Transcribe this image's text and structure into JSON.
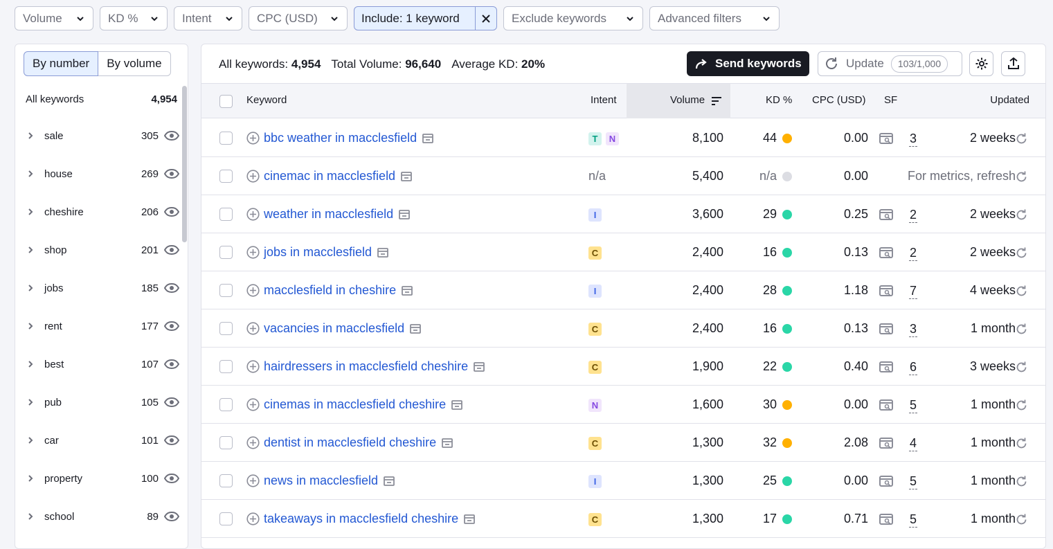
{
  "filters": {
    "volume": "Volume",
    "kd": "KD %",
    "intent": "Intent",
    "cpc": "CPC (USD)",
    "include": "Include: 1 keyword",
    "exclude": "Exclude keywords",
    "advanced": "Advanced filters"
  },
  "groups_panel": {
    "by_number": "By number",
    "by_volume": "By volume",
    "all_label": "All keywords",
    "all_count": "4,954",
    "items": [
      {
        "name": "sale",
        "count": "305"
      },
      {
        "name": "house",
        "count": "269"
      },
      {
        "name": "cheshire",
        "count": "206"
      },
      {
        "name": "shop",
        "count": "201"
      },
      {
        "name": "jobs",
        "count": "185"
      },
      {
        "name": "rent",
        "count": "177"
      },
      {
        "name": "best",
        "count": "107"
      },
      {
        "name": "pub",
        "count": "105"
      },
      {
        "name": "car",
        "count": "101"
      },
      {
        "name": "property",
        "count": "100"
      },
      {
        "name": "school",
        "count": "89"
      }
    ]
  },
  "summary": {
    "all_label": "All keywords:",
    "all_value": "4,954",
    "volume_label": "Total Volume:",
    "volume_value": "96,640",
    "kd_label": "Average KD:",
    "kd_value": "20%"
  },
  "toolbar": {
    "send_label": "Send keywords",
    "update_label": "Update",
    "update_quota": "103/1,000"
  },
  "table": {
    "headers": {
      "keyword": "Keyword",
      "intent": "Intent",
      "volume": "Volume",
      "kd": "KD %",
      "cpc": "CPC (USD)",
      "sf": "SF",
      "updated": "Updated"
    },
    "colors": {
      "intent_T": "#d3f3ee",
      "intent_T_text": "#009f81",
      "intent_N": "#f1e5fc",
      "intent_N_text": "#8649e1",
      "intent_I": "#dee4fe",
      "intent_I_text": "#3c62e5",
      "intent_C": "#ffe28f",
      "intent_C_text": "#6b4d00",
      "kd_orange": "#ffb000",
      "kd_green": "#2ad6a7",
      "kd_gray": "#dcdde3"
    },
    "rows": [
      {
        "keyword": "bbc weather in macclesfield",
        "intents": [
          "T",
          "N"
        ],
        "volume": "8,100",
        "kd": "44",
        "kd_color": "orange",
        "cpc": "0.00",
        "sf": "3",
        "updated": "2 weeks"
      },
      {
        "keyword": "cinemac in macclesfield",
        "intents": [],
        "intent_na": "n/a",
        "volume": "5,400",
        "kd": "n/a",
        "kd_color": "gray",
        "cpc": "0.00",
        "sf": "",
        "updated": "For metrics, refresh"
      },
      {
        "keyword": "weather in macclesfield",
        "intents": [
          "I"
        ],
        "volume": "3,600",
        "kd": "29",
        "kd_color": "green",
        "cpc": "0.25",
        "sf": "2",
        "updated": "2 weeks"
      },
      {
        "keyword": "jobs in macclesfield",
        "intents": [
          "C"
        ],
        "volume": "2,400",
        "kd": "16",
        "kd_color": "green",
        "cpc": "0.13",
        "sf": "2",
        "updated": "2 weeks"
      },
      {
        "keyword": "macclesfield in cheshire",
        "intents": [
          "I"
        ],
        "volume": "2,400",
        "kd": "28",
        "kd_color": "green",
        "cpc": "1.18",
        "sf": "7",
        "updated": "4 weeks"
      },
      {
        "keyword": "vacancies in macclesfield",
        "intents": [
          "C"
        ],
        "volume": "2,400",
        "kd": "16",
        "kd_color": "green",
        "cpc": "0.13",
        "sf": "3",
        "updated": "1 month"
      },
      {
        "keyword": "hairdressers in macclesfield cheshire",
        "intents": [
          "C"
        ],
        "volume": "1,900",
        "kd": "22",
        "kd_color": "green",
        "cpc": "0.40",
        "sf": "6",
        "updated": "3 weeks"
      },
      {
        "keyword": "cinemas in macclesfield cheshire",
        "intents": [
          "N"
        ],
        "volume": "1,600",
        "kd": "30",
        "kd_color": "orange",
        "cpc": "0.00",
        "sf": "5",
        "updated": "1 month"
      },
      {
        "keyword": "dentist in macclesfield cheshire",
        "intents": [
          "C"
        ],
        "volume": "1,300",
        "kd": "32",
        "kd_color": "orange",
        "cpc": "2.08",
        "sf": "4",
        "updated": "1 month"
      },
      {
        "keyword": "news in macclesfield",
        "intents": [
          "I"
        ],
        "volume": "1,300",
        "kd": "25",
        "kd_color": "green",
        "cpc": "0.00",
        "sf": "5",
        "updated": "1 month"
      },
      {
        "keyword": "takeaways in macclesfield cheshire",
        "intents": [
          "C"
        ],
        "volume": "1,300",
        "kd": "17",
        "kd_color": "green",
        "cpc": "0.71",
        "sf": "5",
        "updated": "1 month"
      }
    ]
  }
}
